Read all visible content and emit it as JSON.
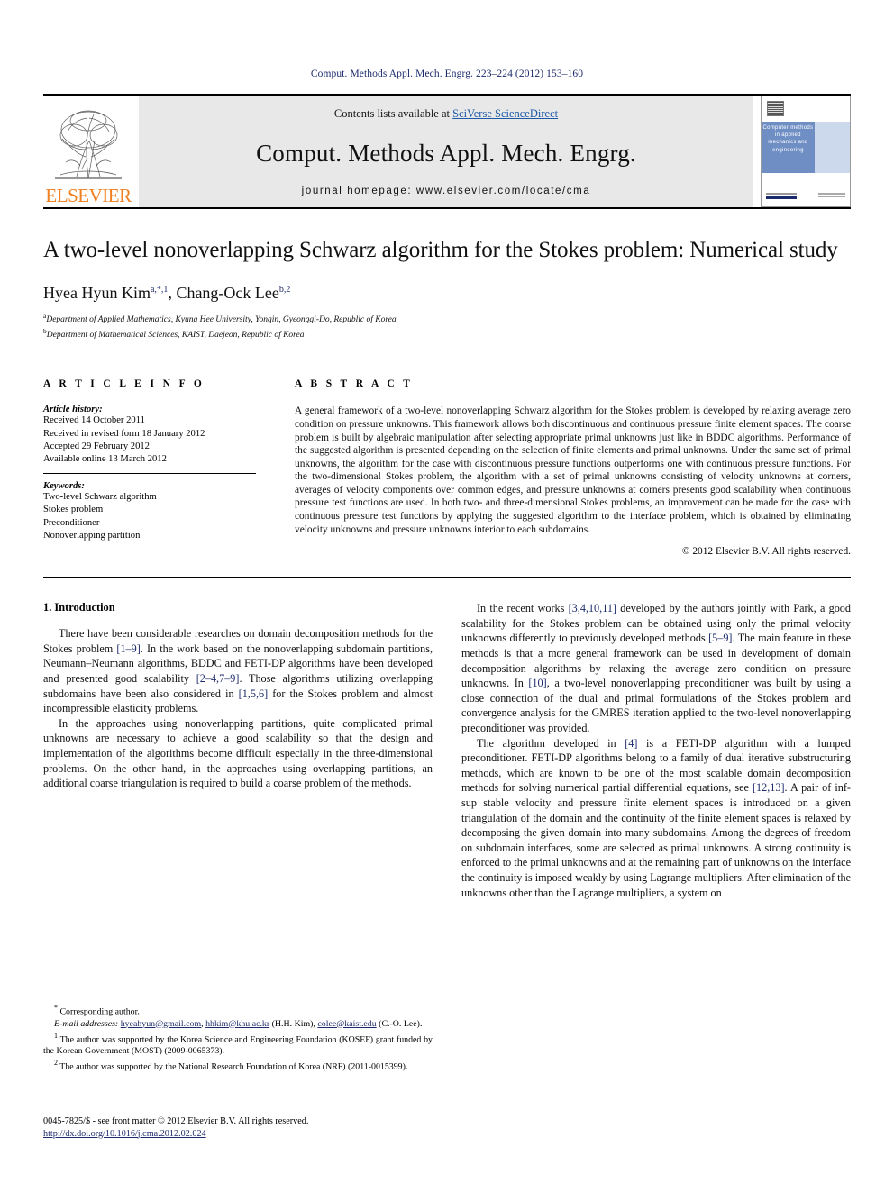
{
  "running_head": "Comput. Methods Appl. Mech. Engrg. 223–224 (2012) 153–160",
  "header": {
    "publisher_name": "ELSEVIER",
    "contents_prefix": "Contents lists available at ",
    "contents_link": "SciVerse ScienceDirect",
    "journal_title": "Comput. Methods Appl. Mech. Engrg.",
    "homepage": "journal homepage: www.elsevier.com/locate/cma",
    "cover_text": "Computer methods in applied mechanics and engineering"
  },
  "article": {
    "title": "A two-level nonoverlapping Schwarz algorithm for the Stokes problem: Numerical study",
    "authors_html": "Hyea Hyun Kim a,*,1, Chang-Ock Lee b,2",
    "author1_name": "Hyea Hyun Kim",
    "author1_sup": "a,*,1",
    "author2_name": ", Chang-Ock Lee",
    "author2_sup": "b,2",
    "affiliation_a_sup": "a",
    "affiliation_a": "Department of Applied Mathematics, Kyung Hee University, Yongin, Gyeonggi-Do, Republic of Korea",
    "affiliation_b_sup": "b",
    "affiliation_b": "Department of Mathematical Sciences, KAIST, Daejeon, Republic of Korea"
  },
  "article_info": {
    "label": "A R T I C L E   I N F O",
    "history_label": "Article history:",
    "history": [
      "Received 14 October 2011",
      "Received in revised form 18 January 2012",
      "Accepted 29 February 2012",
      "Available online 13 March 2012"
    ],
    "keywords_label": "Keywords:",
    "keywords": [
      "Two-level Schwarz algorithm",
      "Stokes problem",
      "Preconditioner",
      "Nonoverlapping partition"
    ]
  },
  "abstract": {
    "label": "A B S T R A C T",
    "text": "A general framework of a two-level nonoverlapping Schwarz algorithm for the Stokes problem is developed by relaxing average zero condition on pressure unknowns. This framework allows both discontinuous and continuous pressure finite element spaces. The coarse problem is built by algebraic manipulation after selecting appropriate primal unknowns just like in BDDC algorithms. Performance of the suggested algorithm is presented depending on the selection of finite elements and primal unknowns. Under the same set of primal unknowns, the algorithm for the case with discontinuous pressure functions outperforms one with continuous pressure functions. For the two-dimensional Stokes problem, the algorithm with a set of primal unknowns consisting of velocity unknowns at corners, averages of velocity components over common edges, and pressure unknowns at corners presents good scalability when continuous pressure test functions are used. In both two- and three-dimensional Stokes problems, an improvement can be made for the case with continuous pressure test functions by applying the suggested algorithm to the interface problem, which is obtained by eliminating velocity unknowns and pressure unknowns interior to each subdomains.",
    "copyright": "© 2012 Elsevier B.V. All rights reserved."
  },
  "body": {
    "section_heading": "1. Introduction",
    "left_p1_a": "There have been considerable researches on domain decomposition methods for the Stokes problem ",
    "left_p1_r1": "[1–9]",
    "left_p1_b": ". In the work based on the nonoverlapping subdomain partitions, Neumann–Neumann algorithms, BDDC and FETI-DP algorithms have been developed and presented good scalability ",
    "left_p1_r2": "[2–4,7–9]",
    "left_p1_c": ". Those algorithms utilizing overlapping subdomains have been also considered in ",
    "left_p1_r3": "[1,5,6]",
    "left_p1_d": " for the Stokes problem and almost incompressible elasticity problems.",
    "left_p2": "In the approaches using nonoverlapping partitions, quite complicated primal unknowns are necessary to achieve a good scalability so that the design and implementation of the algorithms become difficult especially in the three-dimensional problems. On the other hand, in the approaches using overlapping partitions, an additional coarse triangulation is required to build a coarse problem of the methods.",
    "right_p1_a": "In the recent works ",
    "right_p1_r1": "[3,4,10,11]",
    "right_p1_b": " developed by the authors jointly with Park, a good scalability for the Stokes problem can be obtained using only the primal velocity unknowns differently to previously developed methods ",
    "right_p1_r2": "[5–9]",
    "right_p1_c": ". The main feature in these methods is that a more general framework can be used in development of domain decomposition algorithms by relaxing the average zero condition on pressure unknowns. In ",
    "right_p1_r3": "[10]",
    "right_p1_d": ", a two-level nonoverlapping preconditioner was built by using a close connection of the dual and primal formulations of the Stokes problem and convergence analysis for the GMRES iteration applied to the two-level nonoverlapping preconditioner was provided.",
    "right_p2_a": "The algorithm developed in ",
    "right_p2_r1": "[4]",
    "right_p2_b": " is a FETI-DP algorithm with a lumped preconditioner. FETI-DP algorithms belong to a family of dual iterative substructuring methods, which are known to be one of the most scalable domain decomposition methods for solving numerical partial differential equations, see ",
    "right_p2_r2": "[12,13]",
    "right_p2_c": ". A pair of inf-sup stable velocity and pressure finite element spaces is introduced on a given triangulation of the domain and the continuity of the finite element spaces is relaxed by decomposing the given domain into many subdomains. Among the degrees of freedom on subdomain interfaces, some are selected as primal unknowns. A strong continuity is enforced to the primal unknowns and at the remaining part of unknowns on the interface the continuity is imposed weakly by using Lagrange multipliers. After elimination of the unknowns other than the Lagrange multipliers, a system on"
  },
  "footnotes": {
    "corresponding_marker": "*",
    "corresponding": "Corresponding author.",
    "email_label": "E-mail addresses:",
    "email1": "hyeahyun@gmail.com",
    "email_sep1": ", ",
    "email2": "hhkim@khu.ac.kr",
    "email_who1": " (H.H. Kim), ",
    "email3": "colee@kaist.edu",
    "email_who2": " (C.-O. Lee).",
    "fn1_marker": "1",
    "fn1": "The author was supported by the Korea Science and Engineering Foundation (KOSEF) grant funded by the Korean Government (MOST) (2009-0065373).",
    "fn2_marker": "2",
    "fn2": "The author was supported by the National Research Foundation of Korea (NRF) (2011-0015399)."
  },
  "issn": {
    "line1": "0045-7825/$ - see front matter © 2012 Elsevier B.V. All rights reserved.",
    "doi": "http://dx.doi.org/10.1016/j.cma.2012.02.024"
  },
  "colors": {
    "link": "#1c5aa8",
    "ref": "#1d2b6b",
    "elsevier_orange": "#F08020",
    "band_gray": "#e8e8e8",
    "cover_blue": "#6f8fc4"
  }
}
